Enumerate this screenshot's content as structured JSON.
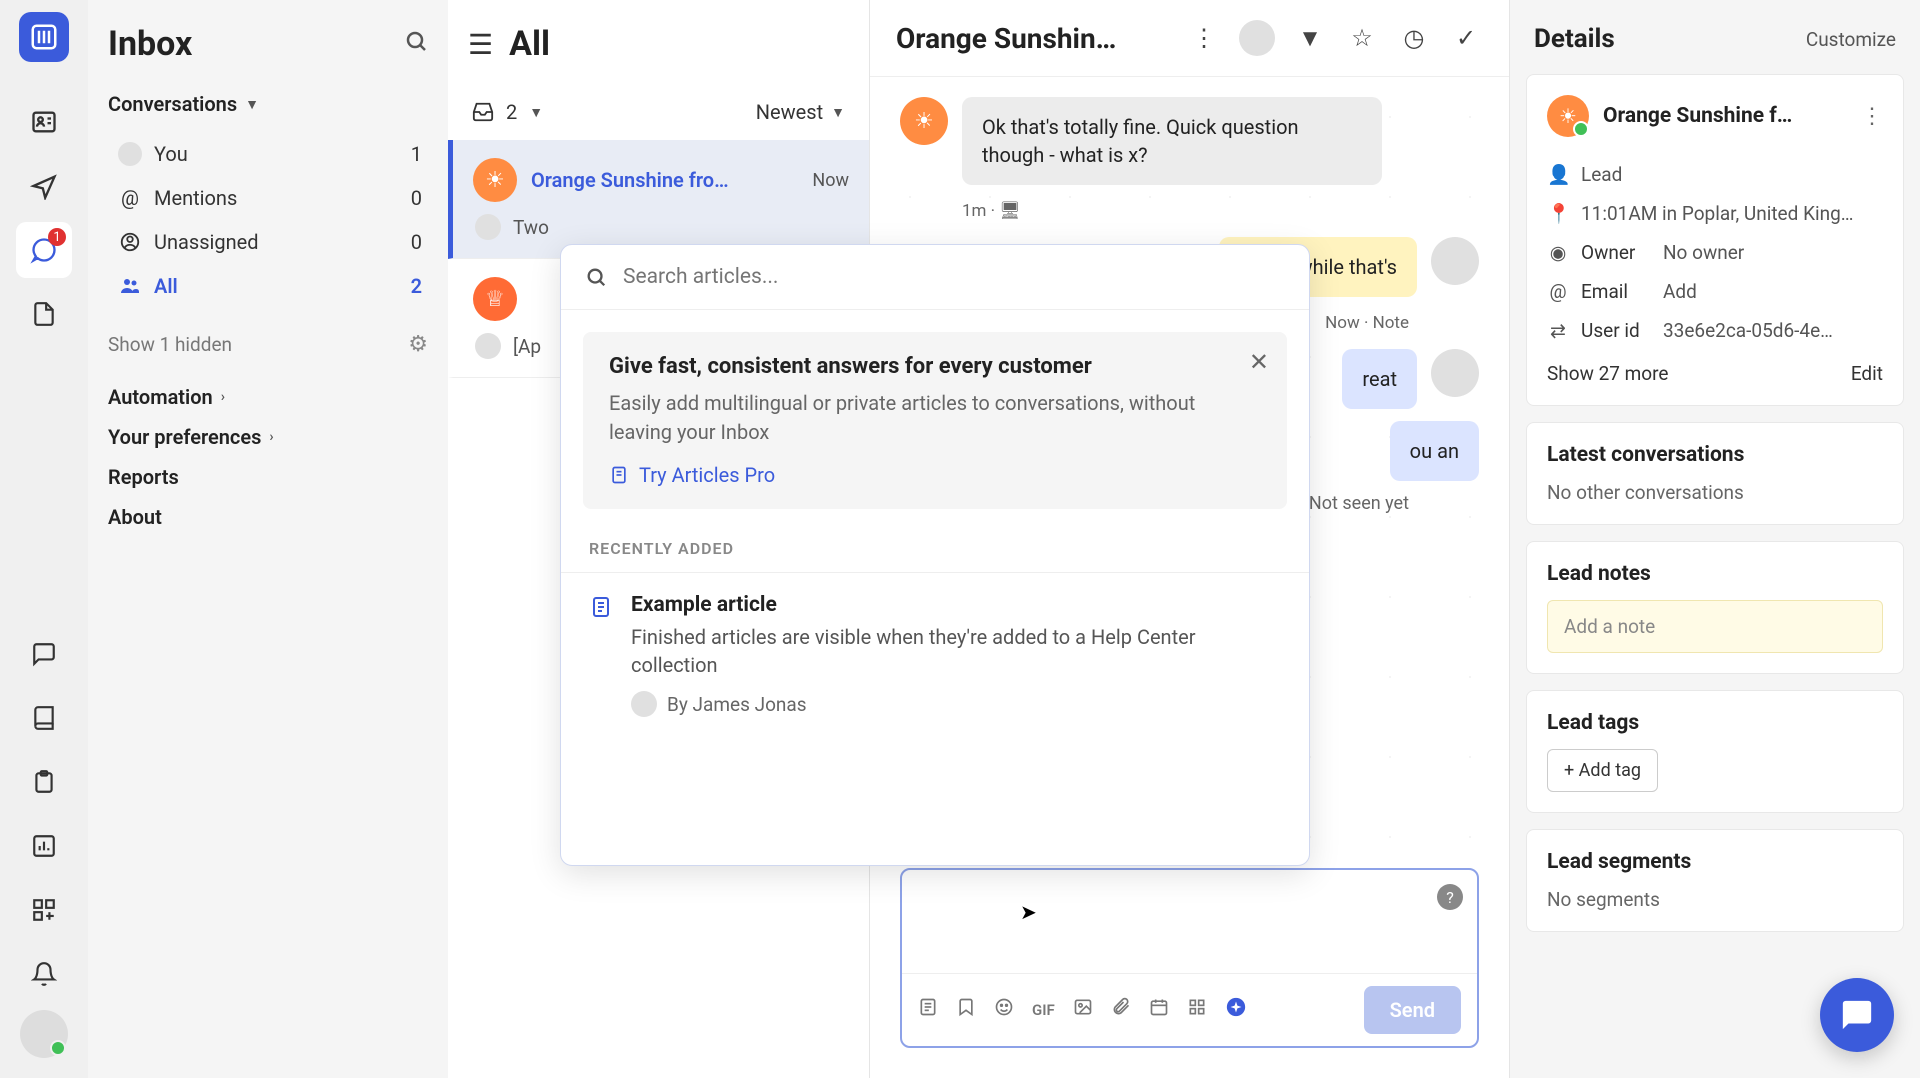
{
  "sidebar": {
    "title": "Inbox",
    "section_conversations": "Conversations",
    "items": [
      {
        "label": "You",
        "count": "1"
      },
      {
        "label": "Mentions",
        "count": "0"
      },
      {
        "label": "Unassigned",
        "count": "0"
      },
      {
        "label": "All",
        "count": "2"
      }
    ],
    "show_hidden": "Show 1 hidden",
    "automation": "Automation",
    "preferences": "Your preferences",
    "reports": "Reports",
    "about": "About"
  },
  "rail": {
    "inbox_badge": "1"
  },
  "convo_list": {
    "title": "All",
    "open_count": "2",
    "sort": "Newest",
    "items": [
      {
        "name": "Orange Sunshine fro…",
        "time": "Now",
        "preview": "Two"
      },
      {
        "name": "",
        "time": "",
        "preview": "[Ap"
      }
    ]
  },
  "conversation": {
    "title": "Orange Sunshin…",
    "msg_incoming": "Ok that's totally fine. Quick question though - what is x?",
    "msg_incoming_meta": "1m ·",
    "msg_note_partial": "cause while that's",
    "note_meta": "Now · Note",
    "msg_reply1_partial": "reat",
    "msg_reply2_partial": "ou an",
    "not_seen": "Not seen yet",
    "send": "Send",
    "gif_label": "GIF"
  },
  "article_popover": {
    "placeholder": "Search articles...",
    "promo_title": "Give fast, consistent answers for every customer",
    "promo_body": "Easily add multilingual or private articles to conversations, without leaving your Inbox",
    "try_link": "Try Articles Pro",
    "section_label": "RECENTLY ADDED",
    "article_title": "Example article",
    "article_body": "Finished articles are visible when they're added to a Help Center collection",
    "article_by": "By James Jonas"
  },
  "details": {
    "title": "Details",
    "customize": "Customize",
    "lead_name": "Orange Sunshine f…",
    "attrs": {
      "lead": "Lead",
      "location": "11:01AM in Poplar, United King…",
      "owner_label": "Owner",
      "owner_val": "No owner",
      "email_label": "Email",
      "email_val": "Add",
      "userid_label": "User id",
      "userid_val": "33e6e2ca-05d6-4e…"
    },
    "show_more": "Show 27 more",
    "edit": "Edit",
    "latest_conv_title": "Latest conversations",
    "latest_conv_empty": "No other conversations",
    "notes_title": "Lead notes",
    "notes_placeholder": "Add a note",
    "tags_title": "Lead tags",
    "add_tag": "+ Add tag",
    "segments_title": "Lead segments",
    "segments_empty": "No segments"
  }
}
